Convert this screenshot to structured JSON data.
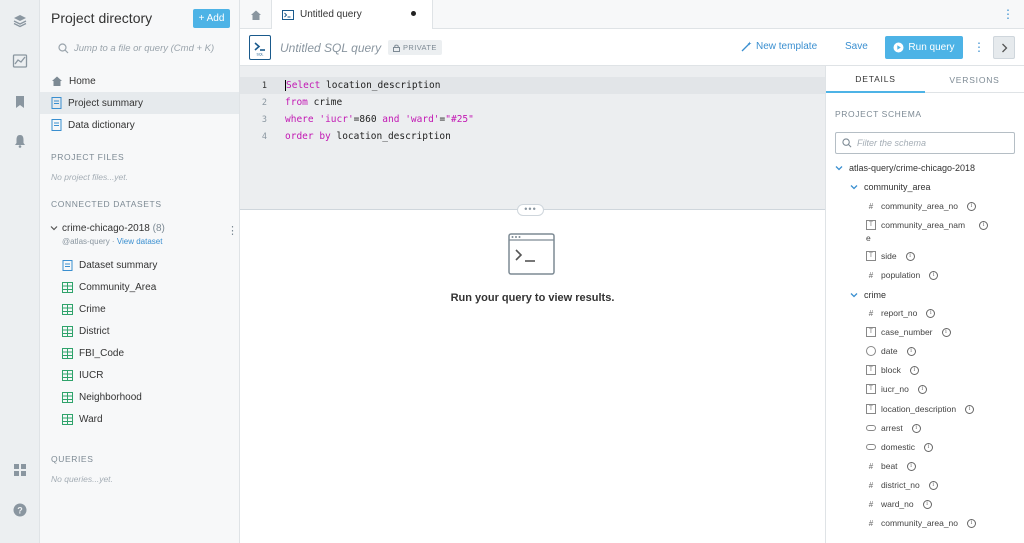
{
  "sidebar": {
    "title": "Project directory",
    "add_label": "+ Add",
    "search_placeholder": "Jump to a file or query (Cmd + K)",
    "nav": [
      {
        "label": "Home",
        "icon": "home-icon"
      },
      {
        "label": "Project summary",
        "icon": "doc-icon"
      },
      {
        "label": "Data dictionary",
        "icon": "doc-icon"
      }
    ],
    "project_files_head": "PROJECT FILES",
    "project_files_empty": "No project files...yet.",
    "connected_head": "CONNECTED DATASETS",
    "dataset": {
      "name": "crime-chicago-2018",
      "count": "(8)",
      "owner": "@atlas-query",
      "view_label": "View dataset",
      "items": [
        "Dataset summary",
        "Community_Area",
        "Crime",
        "District",
        "FBI_Code",
        "IUCR",
        "Neighborhood",
        "Ward"
      ]
    },
    "queries_head": "QUERIES",
    "queries_empty": "No queries...yet."
  },
  "tabs": {
    "query_tab_label": "Untitled query"
  },
  "query": {
    "title": "Untitled SQL query",
    "private_label": "PRIVATE",
    "new_template": "New template",
    "save": "Save",
    "run": "Run query"
  },
  "editor": {
    "lines": [
      {
        "num": "1",
        "kw": "Select",
        "rest": " location_description",
        "current": true
      },
      {
        "num": "2",
        "kw": "from",
        "rest": " crime"
      },
      {
        "num": "3",
        "kw": "where",
        "rest": ""
      },
      {
        "num": "4",
        "kw": "order by",
        "rest": " location_description"
      }
    ],
    "line3": {
      "s1": "'iucr'",
      "op1": "=860 ",
      "and": "and",
      "s2": "'ward'",
      "op2": "=",
      "s3": "\"#25\""
    }
  },
  "results": {
    "message": "Run your query to view results."
  },
  "right_panel": {
    "tab_details": "DETAILS",
    "tab_versions": "VERSIONS",
    "schema_head": "PROJECT SCHEMA",
    "filter_placeholder": "Filter the schema",
    "root": "atlas-query/crime-chicago-2018",
    "tables": [
      {
        "name": "community_area",
        "columns": [
          {
            "name": "community_area_no",
            "type": "#"
          },
          {
            "name": "community_area_nam",
            "type": "T",
            "wrap": "e"
          },
          {
            "name": "side",
            "type": "T"
          },
          {
            "name": "population",
            "type": "#"
          }
        ]
      },
      {
        "name": "crime",
        "columns": [
          {
            "name": "report_no",
            "type": "#"
          },
          {
            "name": "case_number",
            "type": "T"
          },
          {
            "name": "date",
            "type": "clock"
          },
          {
            "name": "block",
            "type": "T"
          },
          {
            "name": "iucr_no",
            "type": "T"
          },
          {
            "name": "location_description",
            "type": "T"
          },
          {
            "name": "arrest",
            "type": "toggle"
          },
          {
            "name": "domestic",
            "type": "toggle"
          },
          {
            "name": "beat",
            "type": "#"
          },
          {
            "name": "district_no",
            "type": "#"
          },
          {
            "name": "ward_no",
            "type": "#"
          },
          {
            "name": "community_area_no",
            "type": "#"
          }
        ]
      }
    ]
  },
  "colors": {
    "accent": "#4db3e6",
    "link": "#3a8fd0",
    "keyword": "#c218b3",
    "brand_dark": "#1a5a8c"
  }
}
